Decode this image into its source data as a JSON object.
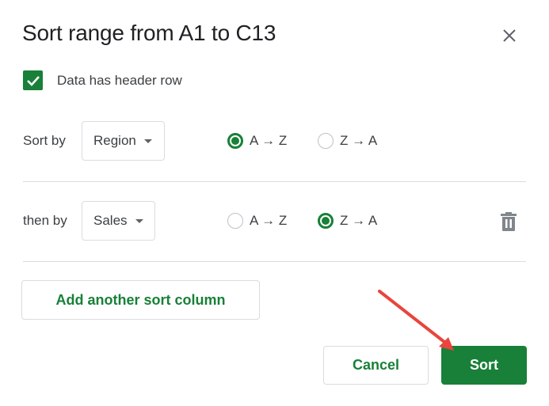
{
  "dialog": {
    "title": "Sort range from A1 to C13",
    "close_icon": "close-icon"
  },
  "header_row": {
    "label": "Data has header row",
    "checked": true
  },
  "sort_rules": [
    {
      "label": "Sort by",
      "column": "Region",
      "options": [
        "A → Z",
        "Z → A"
      ],
      "selected": "A → Z",
      "deletable": false
    },
    {
      "label": "then by",
      "column": "Sales",
      "options": [
        "A → Z",
        "Z → A"
      ],
      "selected": "Z → A",
      "deletable": true
    }
  ],
  "buttons": {
    "add_column": "Add another sort column",
    "cancel": "Cancel",
    "sort": "Sort"
  },
  "colors": {
    "accent": "#188038",
    "annotation_arrow": "#e8453c"
  }
}
